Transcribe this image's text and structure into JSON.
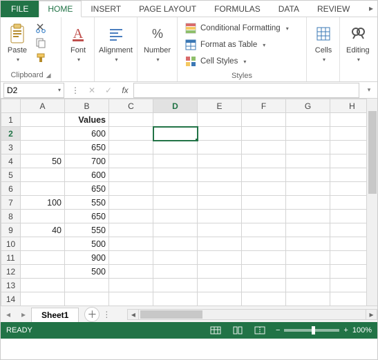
{
  "tabs": {
    "file": "FILE",
    "home": "HOME",
    "insert": "INSERT",
    "page_layout": "PAGE LAYOUT",
    "formulas": "FORMULAS",
    "data": "DATA",
    "review": "REVIEW"
  },
  "ribbon": {
    "clipboard": {
      "paste": "Paste",
      "label": "Clipboard"
    },
    "font": {
      "btn": "Font"
    },
    "alignment": {
      "btn": "Alignment"
    },
    "number": {
      "btn": "Number"
    },
    "styles": {
      "conditional": "Conditional Formatting",
      "format_table": "Format as Table",
      "cell_styles": "Cell Styles",
      "label": "Styles"
    },
    "cells": {
      "btn": "Cells"
    },
    "editing": {
      "btn": "Editing"
    }
  },
  "namebox": {
    "value": "D2"
  },
  "grid": {
    "columns": [
      "A",
      "B",
      "C",
      "D",
      "E",
      "F",
      "G",
      "H"
    ],
    "selected_col": "D",
    "selected_row": 2,
    "rows": [
      {
        "n": 1,
        "A": "",
        "B": "Values",
        "B_bold": true
      },
      {
        "n": 2,
        "A": "",
        "B": "600"
      },
      {
        "n": 3,
        "A": "",
        "B": "650"
      },
      {
        "n": 4,
        "A": "50",
        "B": "700"
      },
      {
        "n": 5,
        "A": "",
        "B": "600"
      },
      {
        "n": 6,
        "A": "",
        "B": "650"
      },
      {
        "n": 7,
        "A": "100",
        "B": "550"
      },
      {
        "n": 8,
        "A": "",
        "B": "650"
      },
      {
        "n": 9,
        "A": "40",
        "B": "550"
      },
      {
        "n": 10,
        "A": "",
        "B": "500"
      },
      {
        "n": 11,
        "A": "",
        "B": "900"
      },
      {
        "n": 12,
        "A": "",
        "B": "500"
      },
      {
        "n": 13,
        "A": "",
        "B": ""
      },
      {
        "n": 14,
        "A": "",
        "B": ""
      }
    ]
  },
  "sheet": {
    "name": "Sheet1"
  },
  "status": {
    "ready": "READY",
    "zoom": "100%"
  }
}
